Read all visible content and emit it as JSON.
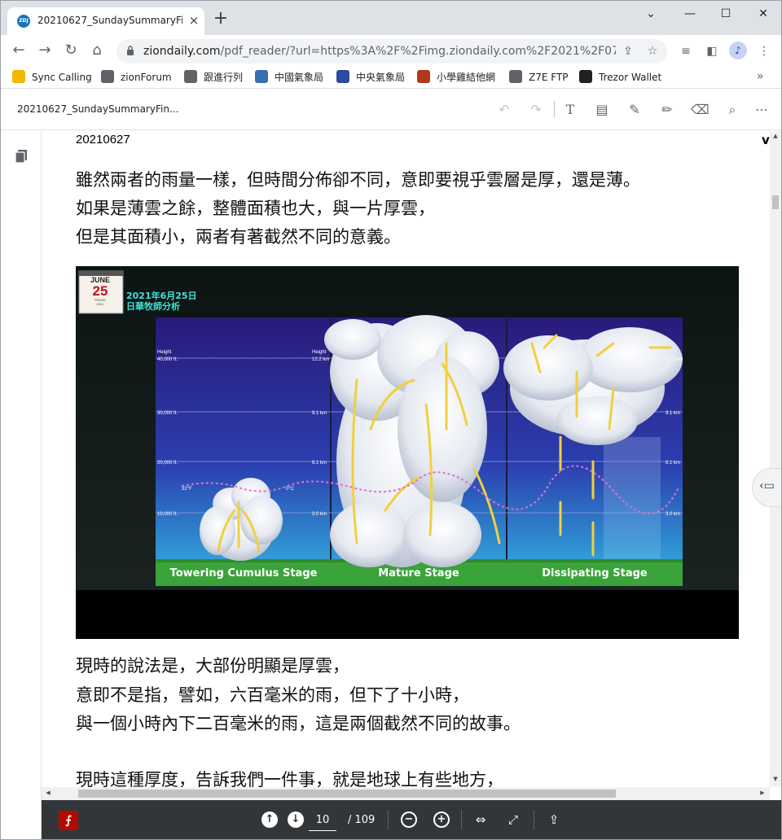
{
  "browser": {
    "tab_title": "20210627_SundaySummaryFin",
    "tab_favicon_text": "ZDJ",
    "new_tab": "+",
    "url_host": "ziondaily.com",
    "url_rest": "/pdf_reader/?url=https%3A%2F%2Fimg.ziondaily.com%2F2021%2F07%...",
    "window_controls": [
      "minimize-icon",
      "maximize-icon",
      "close-icon"
    ]
  },
  "bookmarks": [
    {
      "label": "Sync Calling",
      "icon": "sync-calling-icon",
      "color": "#f2b705"
    },
    {
      "label": "zionForum",
      "icon": "globe-icon",
      "color": "#5f6368"
    },
    {
      "label": "跟進行列",
      "icon": "globe-icon",
      "color": "#5f6368"
    },
    {
      "label": "中國氣象局",
      "icon": "weather-bureau-icon",
      "color": "#3a6fb0"
    },
    {
      "label": "中央氣象局",
      "icon": "weather-bureau-icon",
      "color": "#2b4aa0"
    },
    {
      "label": "小學雞結他網",
      "icon": "guitar-site-icon",
      "color": "#b03a1a"
    },
    {
      "label": "Z7E FTP",
      "icon": "globe-icon",
      "color": "#5f6368"
    },
    {
      "label": "Trezor Wallet",
      "icon": "lock-icon",
      "color": "#202124"
    }
  ],
  "pdf": {
    "file_title": "20210627_SundaySummaryFin...",
    "page_label": "20210627",
    "clipped_right": "v",
    "current_page": "10",
    "total_pages": "/ 109"
  },
  "content": {
    "paragraph1": [
      "雖然兩者的雨量一樣，但時間分佈卻不同，意即要視乎雲層是厚，還是薄。",
      "如果是薄雲之餘，整體面積也大，與一片厚雲，",
      "但是其面積小，兩者有著截然不同的意義。"
    ],
    "paragraph2": [
      "現時的說法是，大部份明顯是厚雲，",
      "意即不是指，譬如，六百毫米的雨，但下了十小時，",
      "與一個小時內下二百毫米的雨，這是兩個截然不同的故事。"
    ],
    "paragraph3": [
      "現時這種厚度，告訴我們一件事，就是地球上有些地方，"
    ]
  },
  "figure": {
    "calendar_month": "JUNE",
    "calendar_day": "25",
    "calendar_weekday": "FRIDAY",
    "calendar_year": "2021",
    "caption_line1": "2021年6月25日",
    "caption_line2": "日華牧師分析",
    "panels": [
      {
        "label": "Towering Cumulus Stage"
      },
      {
        "label": "Mature Stage"
      },
      {
        "label": "Dissipating Stage"
      }
    ],
    "left_heights": [
      "Height",
      "40,000 ft.",
      "30,000 ft.",
      "20,000 ft.",
      "10,000 ft."
    ],
    "right_heights": [
      "Height",
      "12.2 km",
      "9.1 km",
      "6.1 km",
      "3.0 km"
    ],
    "freezing_left": "32°F",
    "freezing_right": "0°C"
  }
}
